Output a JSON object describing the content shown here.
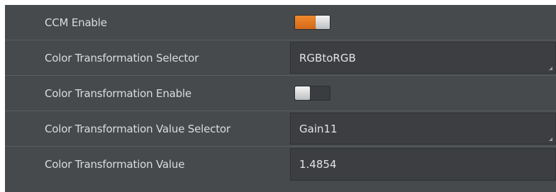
{
  "rows": [
    {
      "label": "CCM Enable",
      "type": "toggle",
      "state": "on"
    },
    {
      "label": "Color Transformation Selector",
      "type": "select",
      "value": "RGBtoRGB"
    },
    {
      "label": "Color Transformation Enable",
      "type": "toggle",
      "state": "off"
    },
    {
      "label": "Color Transformation Value Selector",
      "type": "select",
      "value": "Gain11"
    },
    {
      "label": "Color Transformation Value",
      "type": "input",
      "value": "1.4854"
    }
  ],
  "colors": {
    "panel_bg": "#474a4d",
    "field_bg": "#3c3e41",
    "toggle_on": "#e87c25",
    "text": "#dadcdf"
  }
}
